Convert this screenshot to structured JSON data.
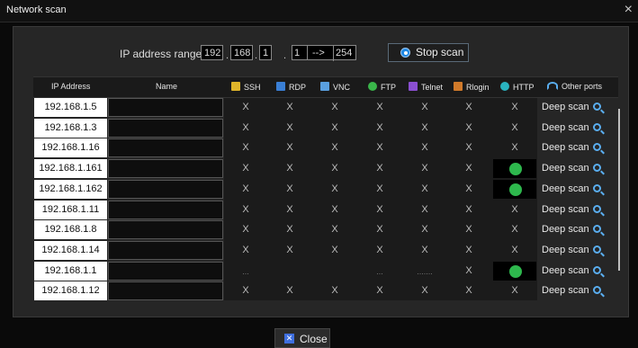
{
  "window": {
    "title": "Network scan",
    "close_glyph": "×"
  },
  "range": {
    "label": "IP address range:",
    "oct1": "192",
    "oct2": "168",
    "oct3": "1",
    "start": "1",
    "arrow": "-->",
    "end": "254",
    "sep": "."
  },
  "stop_button": {
    "label": "Stop scan",
    "icon": "stop-icon"
  },
  "columns": {
    "ip": "IP Address",
    "name": "Name",
    "ssh": "SSH",
    "rdp": "RDP",
    "vnc": "VNC",
    "ftp": "FTP",
    "telnet": "Telnet",
    "rlogin": "Rlogin",
    "http": "HTTP",
    "other": "Other ports"
  },
  "column_icons": {
    "ssh": "ssh-icon",
    "rdp": "rdp-icon",
    "vnc": "vnc-icon",
    "ftp": "ftp-icon",
    "telnet": "telnet-icon",
    "rlogin": "rlogin-icon",
    "http": "http-icon",
    "other": "wifi-icon"
  },
  "deep_scan_label": "Deep scan",
  "x_mark": "X",
  "rows": [
    {
      "ip": "192.168.1.5",
      "name": "",
      "ssh": "X",
      "rdp": "X",
      "vnc": "X",
      "ftp": "X",
      "telnet": "X",
      "rlogin": "X",
      "http": "X"
    },
    {
      "ip": "192.168.1.3",
      "name": "",
      "ssh": "X",
      "rdp": "X",
      "vnc": "X",
      "ftp": "X",
      "telnet": "X",
      "rlogin": "X",
      "http": "X"
    },
    {
      "ip": "192.168.1.16",
      "name": "",
      "ssh": "X",
      "rdp": "X",
      "vnc": "X",
      "ftp": "X",
      "telnet": "X",
      "rlogin": "X",
      "http": "X"
    },
    {
      "ip": "192.168.1.161",
      "name": "",
      "ssh": "X",
      "rdp": "X",
      "vnc": "X",
      "ftp": "X",
      "telnet": "X",
      "rlogin": "X",
      "http": "open"
    },
    {
      "ip": "192.168.1.162",
      "name": "",
      "ssh": "X",
      "rdp": "X",
      "vnc": "X",
      "ftp": "X",
      "telnet": "X",
      "rlogin": "X",
      "http": "open"
    },
    {
      "ip": "192.168.1.11",
      "name": "",
      "ssh": "X",
      "rdp": "X",
      "vnc": "X",
      "ftp": "X",
      "telnet": "X",
      "rlogin": "X",
      "http": "X"
    },
    {
      "ip": "192.168.1.8",
      "name": "",
      "ssh": "X",
      "rdp": "X",
      "vnc": "X",
      "ftp": "X",
      "telnet": "X",
      "rlogin": "X",
      "http": "X"
    },
    {
      "ip": "192.168.1.14",
      "name": "",
      "ssh": "X",
      "rdp": "X",
      "vnc": "X",
      "ftp": "X",
      "telnet": "X",
      "rlogin": "X",
      "http": "X"
    },
    {
      "ip": "192.168.1.1",
      "name": "",
      "ssh": "...",
      "rdp": "",
      "vnc": "",
      "ftp": "...",
      "telnet": ".......",
      "rlogin": "X",
      "http": "open"
    },
    {
      "ip": "192.168.1.12",
      "name": "",
      "ssh": "X",
      "rdp": "X",
      "vnc": "X",
      "ftp": "X",
      "telnet": "X",
      "rlogin": "X",
      "http": "X"
    }
  ],
  "close_button": {
    "label": "Close",
    "icon": "close-box-icon"
  },
  "colors": {
    "accent": "#1e88e5",
    "open": "#2eb84d",
    "search": "#5aaef0"
  }
}
